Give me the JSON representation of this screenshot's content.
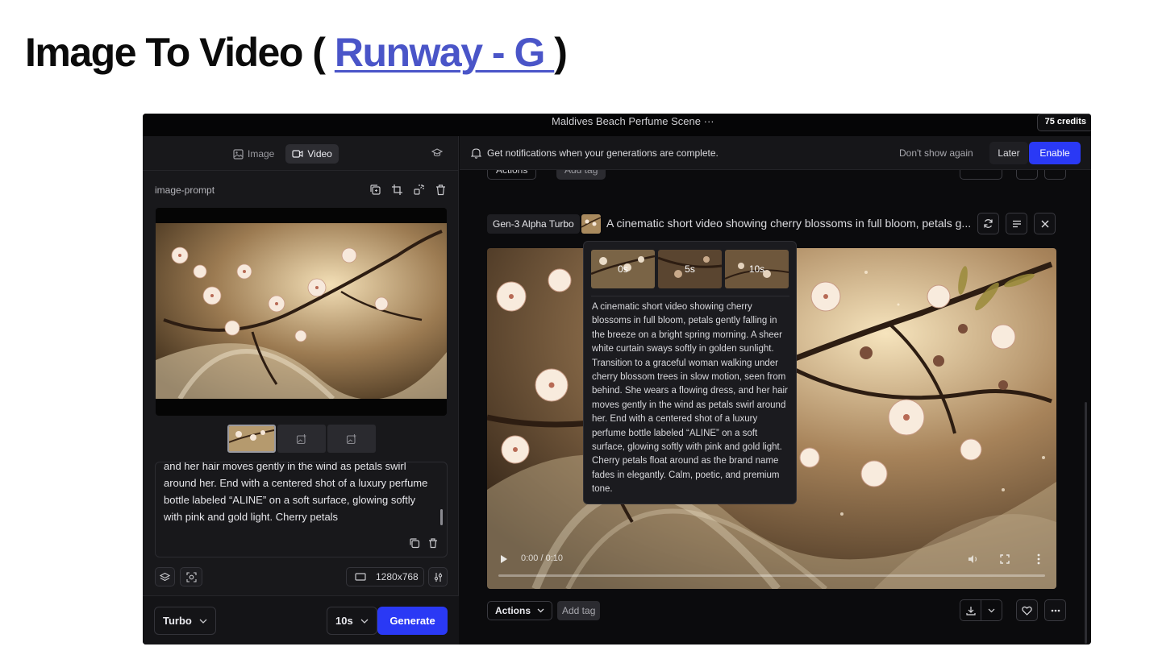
{
  "heading": {
    "prefix": "Image To Video (",
    "link": "Runway - G ",
    "suffix": ")"
  },
  "window": {
    "title": "Maldives Beach Perfume Scene",
    "title_menu": "···",
    "credits": "75 credits"
  },
  "left_panel": {
    "tabs": [
      {
        "label": "Image",
        "icon": "image-icon"
      },
      {
        "label": "Video",
        "icon": "video-icon",
        "active": true
      }
    ],
    "prompt_label": "image-prompt",
    "prompt_text": "and her hair moves gently in the wind as petals swirl around her. End with a centered shot of a luxury perfume bottle labeled “ALINE” on a soft surface, glowing softly with pink and gold light. Cherry petals",
    "resolution": "1280x768",
    "model": "Turbo",
    "duration": "10s",
    "generate_label": "Generate"
  },
  "notification": {
    "text": "Get notifications when your generations are complete.",
    "dont_show": "Don't show again",
    "later": "Later",
    "enable": "Enable"
  },
  "ghost_row": {
    "actions": "Actions",
    "add_tag": "Add tag"
  },
  "generation": {
    "model_tag": "Gen-3 Alpha Turbo",
    "title": "A cinematic short video showing cherry blossoms in full bloom, petals g...",
    "time": "0:00 / 0:10",
    "frames": [
      "0s",
      "5s",
      "10s"
    ],
    "full_prompt": "A cinematic short video showing cherry blossoms in full bloom, petals gently falling in the breeze on a bright spring morning. A sheer white curtain sways softly in golden sunlight. Transition to a graceful woman walking under cherry blossom trees in slow motion, seen from behind. She wears a flowing dress, and her hair moves gently in the wind as petals swirl around her. End with a centered shot of a luxury perfume bottle labeled “ALINE” on a soft surface, glowing softly with pink and gold light. Cherry petals float around as the brand name fades in elegantly. Calm, poetic, and premium tone.",
    "actions": "Actions",
    "add_tag": "Add tag"
  },
  "colors": {
    "accent": "#2a39f5",
    "link": "#4a55c8",
    "panel": "#18181b",
    "background": "#0b0b0d"
  }
}
